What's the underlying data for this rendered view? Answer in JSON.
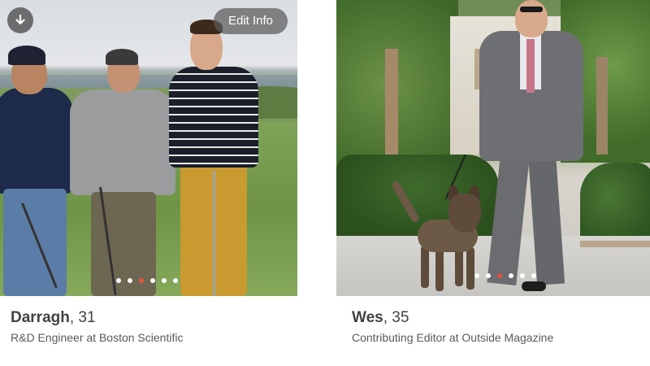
{
  "cards": [
    {
      "name": "Darragh",
      "age_text": ", 31",
      "occupation": "R&D Engineer at Boston Scientific",
      "photo_description": "three-men-on-golf-course",
      "photo_count": 6,
      "active_photo_index": 2
    },
    {
      "name": "Wes",
      "age_text": ", 35",
      "occupation": "Contributing Editor at Outside Magazine",
      "photo_description": "man-in-grey-suit-walking-dog",
      "photo_count": 6,
      "active_photo_index": 2
    }
  ],
  "controls": {
    "edit_info_label": "Edit Info",
    "download_icon": "download-icon"
  },
  "colors": {
    "active_dot": "#e0533f",
    "inactive_dot": "#ffffff",
    "name_text": "#424242",
    "occupation_text": "#5a5a5a"
  }
}
